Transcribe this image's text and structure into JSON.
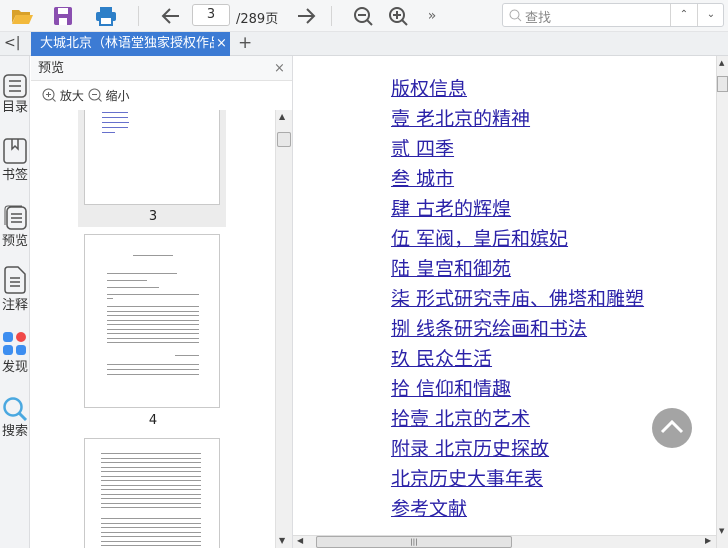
{
  "toolbar": {
    "page_current": "3",
    "page_total": "/289页",
    "search_placeholder": "查找",
    "icons": [
      "folder-open-icon",
      "save-icon",
      "print-icon",
      "arrow-left-icon",
      "arrow-right-icon",
      "zoom-out-icon",
      "zoom-in-icon",
      "more-icon"
    ]
  },
  "tabs": {
    "collapse": "<|",
    "active_title": "大城北京（林语堂独家授权作品",
    "close": "×",
    "add": "+"
  },
  "rail": [
    {
      "label": "目录"
    },
    {
      "label": "书签"
    },
    {
      "label": "预览"
    },
    {
      "label": "注释"
    },
    {
      "label": "发现"
    },
    {
      "label": "搜索"
    }
  ],
  "preview": {
    "title": "预览",
    "close": "×",
    "zoom_in": "放大",
    "zoom_out": "缩小",
    "pages": [
      "3",
      "4"
    ]
  },
  "toc": [
    "版权信息",
    "壹 老北京的精神",
    "贰 四季",
    "叁 城市",
    "肆 古老的辉煌",
    "伍 军阀，皇后和嫔妃",
    "陆 皇宫和御苑",
    "柒 形式研究寺庙、佛塔和雕塑",
    "捌 线条研究绘画和书法",
    "玖 民众生活",
    "拾 信仰和情趣",
    "拾壹 北京的艺术",
    "附录 北京历史探故",
    "北京历史大事年表",
    "参考文献"
  ],
  "colors": {
    "tab_active": "#3c7bd4",
    "link": "#2b22a8",
    "accent_red": "#f04848",
    "accent_blue": "#3d8ef0"
  }
}
